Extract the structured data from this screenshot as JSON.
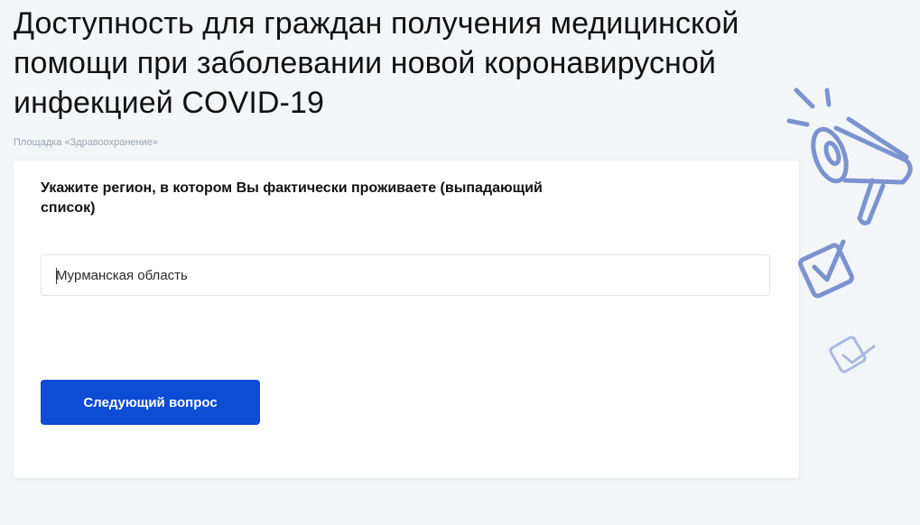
{
  "page": {
    "title": "Доступность для граждан получения медицинской помощи при заболевании новой коронавирусной инфекцией COVID-19",
    "platform": "Площадка «Здравоохранение»"
  },
  "form": {
    "question": "Укажите регион, в котором Вы фактически проживаете (выпадающий список)",
    "region_value": "Мурманская область",
    "next_button_label": "Следующий вопрос"
  },
  "colors": {
    "accent": "#0d4cd3",
    "background": "#f3f6f9",
    "illustration": "#7b93cf"
  },
  "icons": [
    "megaphone-icon",
    "checkbox-icon",
    "checkbox-small-icon"
  ]
}
